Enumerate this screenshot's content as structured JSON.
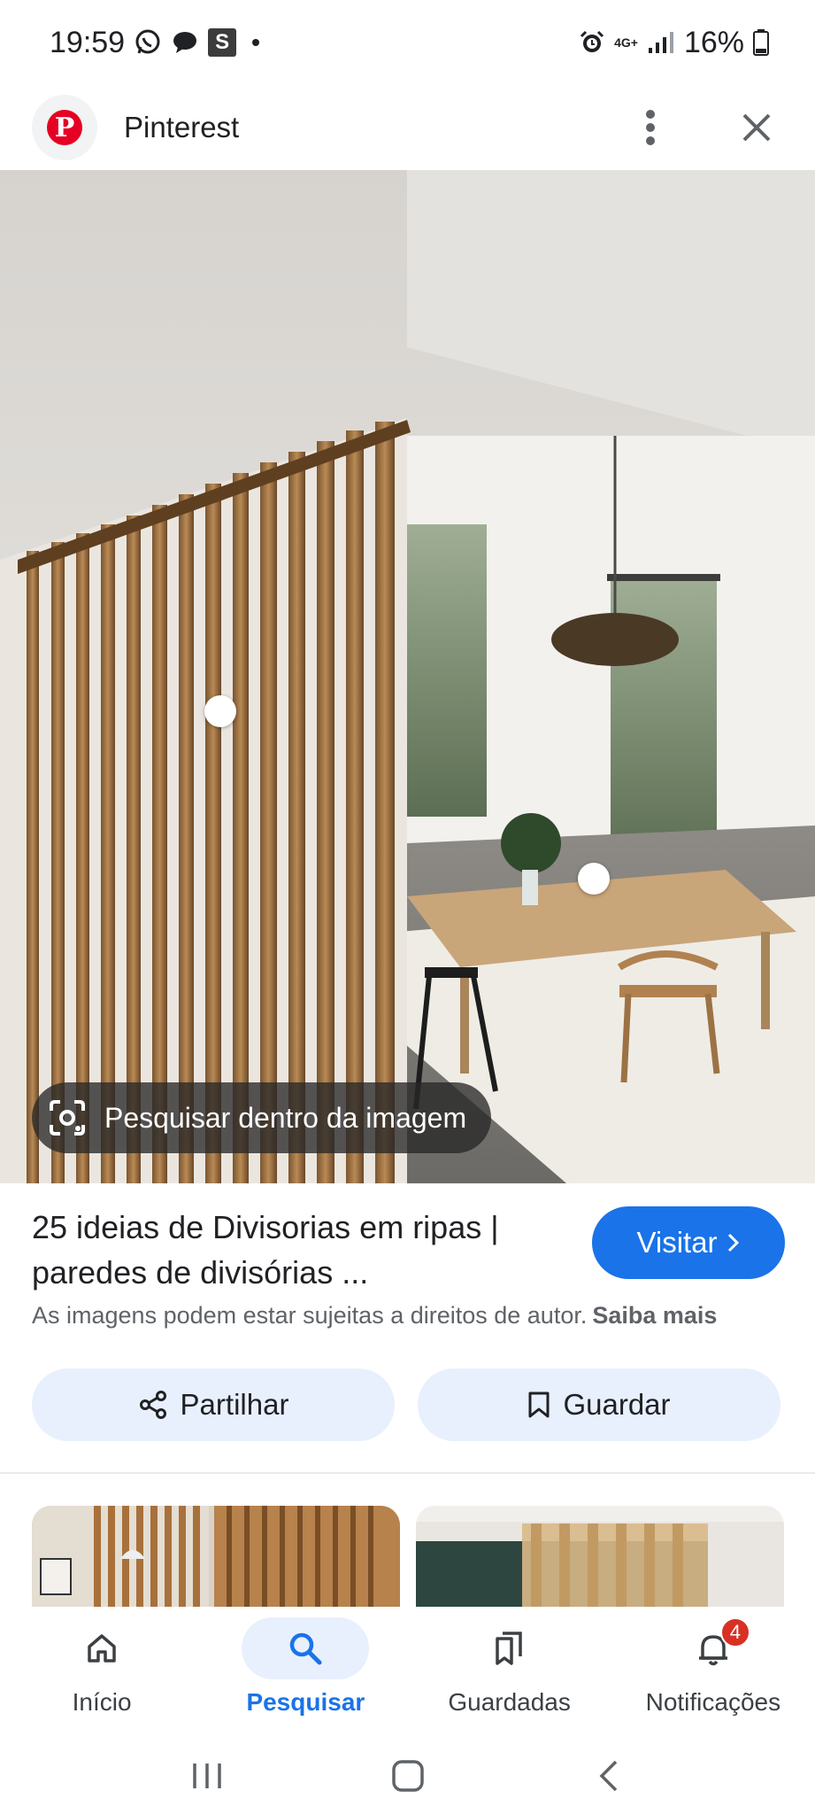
{
  "status_bar": {
    "time": "19:59",
    "network": "4G+",
    "battery": "16%"
  },
  "app_bar": {
    "site_name": "Pinterest"
  },
  "image": {
    "lens_label": "Pesquisar dentro da imagem"
  },
  "result": {
    "title": "25 ideias de Divisorias em ripas | paredes de divisórias ...",
    "visit_label": "Visitar",
    "copyright_text": "As imagens podem estar sujeitas a direitos de autor.",
    "learn_more": "Saiba mais",
    "share_label": "Partilhar",
    "save_label": "Guardar"
  },
  "bottom_nav": {
    "items": [
      {
        "label": "Início",
        "icon": "home-icon"
      },
      {
        "label": "Pesquisar",
        "icon": "search-icon"
      },
      {
        "label": "Guardadas",
        "icon": "bookmarks-icon"
      },
      {
        "label": "Notificações",
        "icon": "bell-icon"
      }
    ],
    "active_index": 1,
    "notification_count": "4"
  },
  "colors": {
    "accent": "#1a73e8",
    "pinterest": "#e60023",
    "button_bg": "#e8f0fe",
    "badge": "#d93025"
  }
}
